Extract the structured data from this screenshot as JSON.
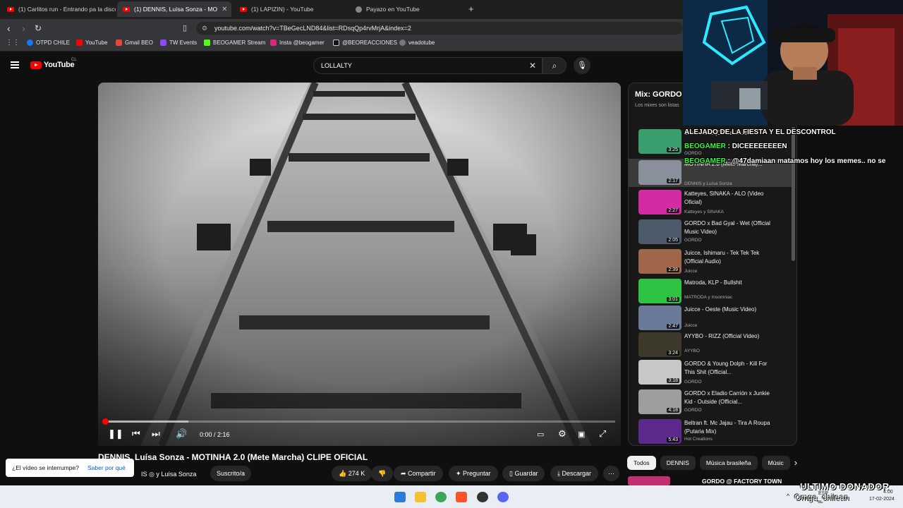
{
  "tabs": [
    {
      "title": "(1) Carlitos run - Entrando pa la disco"
    },
    {
      "title": "(1) DENNIS, Luísa Sonza - MO"
    },
    {
      "title": "(1) LAPIZIN) - YouTube"
    },
    {
      "title": "Payazo en YouTube"
    }
  ],
  "address": {
    "url": "youtube.com/watch?v=TBeGecLND84&list=RDsqQp4rvMrjA&index=2"
  },
  "bookmarks": [
    "OTPD CHILE",
    "YouTube",
    "Gmail BEO",
    "TW Events",
    "BEOGAMER Stream",
    "Insta @beogamer",
    "@BEOREACCIONES",
    "veadotube"
  ],
  "youtube": {
    "logo": "YouTube",
    "country": "CL",
    "search_value": "LOLLALTY",
    "video_time": "0:00 / 2:16",
    "video_title": "DENNIS, Luísa Sonza - MOTINHA 2.0 (Mete Marcha) CLIPE OFICIAL",
    "channel": "IS ◎ y Luísa Sonza",
    "subscribe": "Suscrito/a",
    "likes": "274 K",
    "share": "Compartir",
    "ask": "Preguntar",
    "save": "Guardar",
    "download": "Descargar",
    "toast_text": "¿El vídeo se interrumpe?",
    "toast_link": "Saber por qué"
  },
  "playlist": {
    "title": "Mix: GORDO",
    "subtitle": "Los mixes son listas",
    "items": [
      {
        "title": "Mexe Mexe (Official Music...",
        "channel": "GORDO",
        "dur": "3:25",
        "color": "#3a9e6f"
      },
      {
        "title": "MOTINHA 2.0 (Mete Marcha)...",
        "channel": "DENNIS y Luísa Sonza",
        "dur": "2:17",
        "color": "#8a8f9c"
      },
      {
        "title": "Katteyes, SINAKA - ALO (Video Oficial)",
        "channel": "Katteyes y SINAKA",
        "dur": "2:27",
        "color": "#d42aa3"
      },
      {
        "title": "GORDO x Bad Gyal - Wet (Official Music Video)",
        "channel": "GORDO",
        "dur": "2:05",
        "color": "#4c5a6b"
      },
      {
        "title": "Juicce, Ishimaru - Tek Tek Tek (Official Audio)",
        "channel": "Juicce",
        "dur": "2:39",
        "color": "#a0664a"
      },
      {
        "title": "Matroda, KLP - Bullshit",
        "channel": "MATRODA y Insomniac",
        "dur": "3:01",
        "color": "#2fc243"
      },
      {
        "title": "Juicce - Oeste (Music Video)",
        "channel": "Juicce",
        "dur": "2:47",
        "color": "#6c7a9a"
      },
      {
        "title": "AYYBO - RIZZ (Official Video)",
        "channel": "AYYBO",
        "dur": "3:24",
        "color": "#3d3a2c"
      },
      {
        "title": "GORDO & Young Dolph - Kill For This Shit (Official...",
        "channel": "GORDO",
        "dur": "3:18",
        "color": "#c8c8c8"
      },
      {
        "title": "GORDO x Eladio Carrión x Junkie Kid - Outside (Official...",
        "channel": "GORDO",
        "dur": "4:18",
        "color": "#9e9e9e"
      },
      {
        "title": "Beltran ft. Mc Jajau - Tira A Roupa (Putaria Mix)",
        "channel": "Hot Creations",
        "dur": "5:43",
        "color": "#5b2a8c"
      }
    ],
    "chips": [
      "Todos",
      "DENNIS",
      "Música brasileña",
      "Músic"
    ],
    "next_item": "GORDO @ FACTORY TOWN"
  },
  "stream_chat": [
    {
      "user": "",
      "text": "ALEJADO DE LA FIESTA Y EL DESCONTROL"
    },
    {
      "user": "BEOGAMER",
      "text": " : DICEEEEEEEEN"
    },
    {
      "user": "BEOGAMER",
      "text": " : @47damiaan matamos hoy los memes.. no se"
    }
  ],
  "overlay": {
    "donor_title": "ULTIMO DONADOR",
    "donor_name": "Omga_chilean"
  },
  "taskbar": {
    "lang": "ESP",
    "time": "4:00",
    "date": "17-02-2024"
  }
}
